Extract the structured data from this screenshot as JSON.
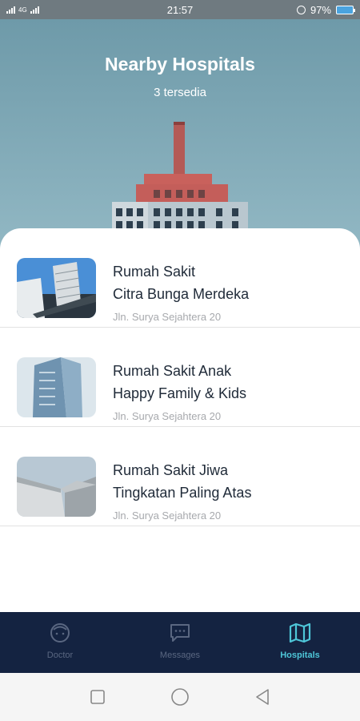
{
  "status_bar": {
    "time": "21:57",
    "battery": "97%",
    "network_text": "4G"
  },
  "header": {
    "title": "Nearby Hospitals",
    "subtitle": "3 tersedia"
  },
  "hospitals": [
    {
      "name_line1": "Rumah Sakit",
      "name_line2": "Citra Bunga Merdeka",
      "address": "Jln. Surya Sejahtera 20"
    },
    {
      "name_line1": "Rumah Sakit Anak",
      "name_line2": "Happy Family & Kids",
      "address": "Jln. Surya Sejahtera 20"
    },
    {
      "name_line1": "Rumah Sakit Jiwa",
      "name_line2": "Tingkatan Paling Atas",
      "address": "Jln. Surya Sejahtera 20"
    }
  ],
  "bottom_nav": {
    "items": [
      {
        "label": "Doctor",
        "icon": "doctor-face-icon",
        "active": false
      },
      {
        "label": "Messages",
        "icon": "messages-icon",
        "active": false
      },
      {
        "label": "Hospitals",
        "icon": "map-icon",
        "active": true
      }
    ]
  },
  "colors": {
    "nav_background": "#142341",
    "nav_active": "#4ec6d8",
    "nav_inactive": "#5a6781",
    "header_sky": "#7fa7b4"
  }
}
